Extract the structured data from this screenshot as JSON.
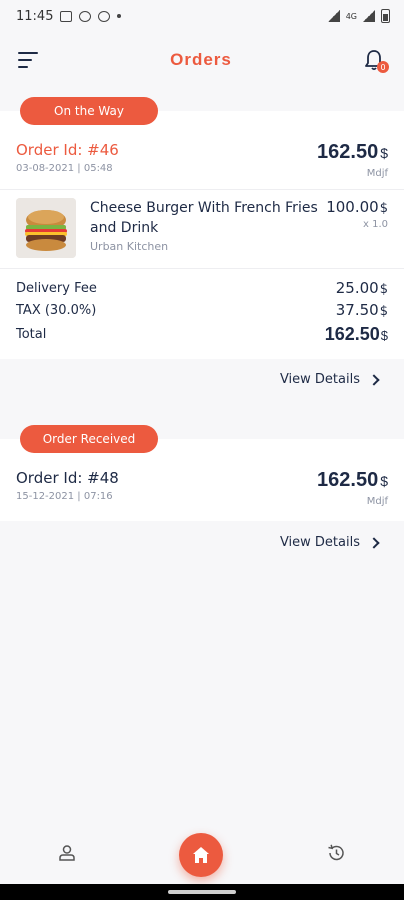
{
  "status_bar": {
    "time": "11:45",
    "network": "4G"
  },
  "header": {
    "title": "Orders",
    "notification_count": "0"
  },
  "orders": [
    {
      "status": "On the Way",
      "order_id": "Order Id: #46",
      "date": "03-08-2021 | 05:48",
      "amount": "162.50",
      "currency": "$",
      "merchant_code": "Mdjf",
      "item": {
        "name": "Cheese Burger With French Fries and Drink",
        "shop": "Urban Kitchen",
        "price": "100.00",
        "currency": "$",
        "qty": "x 1.0"
      },
      "fees": [
        {
          "label": "Delivery Fee",
          "value": "25.00",
          "currency": "$"
        },
        {
          "label": "TAX (30.0%)",
          "value": "37.50",
          "currency": "$"
        }
      ],
      "total_label": "Total",
      "total_value": "162.50",
      "total_currency": "$",
      "view_details": "View Details"
    },
    {
      "status": "Order Received",
      "order_id": "Order Id: #48",
      "date": "15-12-2021 | 07:16",
      "amount": "162.50",
      "currency": "$",
      "merchant_code": "Mdjf",
      "view_details": "View Details"
    }
  ],
  "colors": {
    "accent": "#ec5a3f",
    "text_dark": "#1e2a45",
    "text_muted": "#8d93a3",
    "background": "#f7f7f9"
  },
  "icons": [
    "menu-icon",
    "bell-icon",
    "profile-icon",
    "home-icon",
    "history-icon",
    "chevron-right-icon"
  ]
}
